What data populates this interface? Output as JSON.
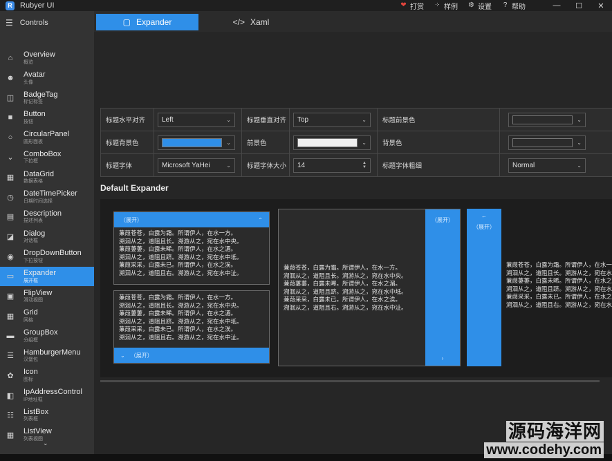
{
  "app": {
    "title": "Rubyer UI",
    "logo_letter": "R"
  },
  "title_actions": [
    {
      "icon": "heart-icon",
      "glyph": "❤",
      "label": "打赏",
      "color": "#e0443c"
    },
    {
      "icon": "grid-icon",
      "glyph": "⁘",
      "label": "样例",
      "color": "#d9d9d9"
    },
    {
      "icon": "gear-icon",
      "glyph": "⚙",
      "label": "设置",
      "color": "#d9d9d9"
    },
    {
      "icon": "help-icon",
      "glyph": "?",
      "label": "帮助",
      "color": "#d9d9d9"
    }
  ],
  "window_controls": {
    "minimize": "—",
    "maximize": "☐",
    "close": "✕"
  },
  "sidebar": {
    "header": "Controls",
    "items": [
      {
        "icon": "home-icon",
        "glyph": "⌂",
        "name": "Overview",
        "sub": "概览"
      },
      {
        "icon": "avatar-icon",
        "glyph": "☻",
        "name": "Avatar",
        "sub": "头像"
      },
      {
        "icon": "badge-icon",
        "glyph": "◫",
        "name": "BadgeTag",
        "sub": "标记标签"
      },
      {
        "icon": "button-icon",
        "glyph": "■",
        "name": "Button",
        "sub": "按钮"
      },
      {
        "icon": "circle-icon",
        "glyph": "○",
        "name": "CircularPanel",
        "sub": "圆形面板"
      },
      {
        "icon": "combobox-icon",
        "glyph": "⌄",
        "name": "ComboBox",
        "sub": "下拉框"
      },
      {
        "icon": "datagrid-icon",
        "glyph": "▦",
        "name": "DataGrid",
        "sub": "数据表格"
      },
      {
        "icon": "clock-icon",
        "glyph": "◷",
        "name": "DateTimePicker",
        "sub": "日期时间选择"
      },
      {
        "icon": "description-icon",
        "glyph": "▤",
        "name": "Description",
        "sub": "描述列表"
      },
      {
        "icon": "dialog-icon",
        "glyph": "◪",
        "name": "Dialog",
        "sub": "对话框"
      },
      {
        "icon": "dropdown-icon",
        "glyph": "◉",
        "name": "DropDownButton",
        "sub": "下拉按钮"
      },
      {
        "icon": "expander-icon",
        "glyph": "▭",
        "name": "Expander",
        "sub": "展开框",
        "active": true
      },
      {
        "icon": "image-icon",
        "glyph": "▣",
        "name": "FlipView",
        "sub": "滑动视图"
      },
      {
        "icon": "grid-layout-icon",
        "glyph": "▦",
        "name": "Grid",
        "sub": "网格"
      },
      {
        "icon": "groupbox-icon",
        "glyph": "▬",
        "name": "GroupBox",
        "sub": "分组框"
      },
      {
        "icon": "hamburger-icon",
        "glyph": "☰",
        "name": "HamburgerMenu",
        "sub": "汉堡包"
      },
      {
        "icon": "icon-icon",
        "glyph": "✿",
        "name": "Icon",
        "sub": "图标"
      },
      {
        "icon": "ip-icon",
        "glyph": "◧",
        "name": "IpAddressControl",
        "sub": "IP地址框"
      },
      {
        "icon": "list-icon",
        "glyph": "☷",
        "name": "ListBox",
        "sub": "列表框"
      },
      {
        "icon": "listview-icon",
        "glyph": "▦",
        "name": "ListView",
        "sub": "列表视图"
      }
    ],
    "scroll_down": "⌄"
  },
  "tabs": [
    {
      "icon": "window-icon",
      "glyph": "▢",
      "label": "Expander",
      "active": true
    },
    {
      "icon": "code-icon",
      "glyph": "</>",
      "label": "Xaml",
      "active": false
    }
  ],
  "props": {
    "row1": [
      {
        "label": "标题水平对齐",
        "value": "Left"
      },
      {
        "label": "标题垂直对齐",
        "value": "Top"
      },
      {
        "label": "标题前景色"
      }
    ],
    "row2": [
      {
        "label": "标题背景色"
      },
      {
        "label": "前景色"
      },
      {
        "label": "背景色"
      }
    ],
    "row3": [
      {
        "label": "标题字体",
        "value": "Microsoft YaHei"
      },
      {
        "label": "标题字体大小",
        "value": "14"
      },
      {
        "label": "标题字体粗细",
        "value": "Normal"
      }
    ],
    "colors": {
      "title_fg": "#2b2b2b",
      "title_bg": "#2f8fe8",
      "fg": "#efefef",
      "bg": "#2b2b2b"
    }
  },
  "section_title": "Default Expander",
  "expander": {
    "header_label": "（展开）",
    "expand_glyph": "⌃",
    "collapse_glyph": "⌄",
    "left_arrow": "←",
    "right_arrow": "›",
    "poem": [
      "蒹葭苍苍，白露为霜。所谓伊人，在水一方。",
      "溯洄从之，道阻且长。溯游从之，宛在水中央。",
      "蒹葭萋萋，白露未晞。所谓伊人，在水之湄。",
      "溯洄从之，道阻且跻。溯游从之，宛在水中坻。",
      "蒹葭采采，白露未已。所谓伊人，在水之涘。",
      "溯洄从之，道阻且右。溯游从之，宛在水中沚。"
    ]
  },
  "watermark": {
    "cn": "源码海洋网",
    "url": "www.codehy.com"
  }
}
